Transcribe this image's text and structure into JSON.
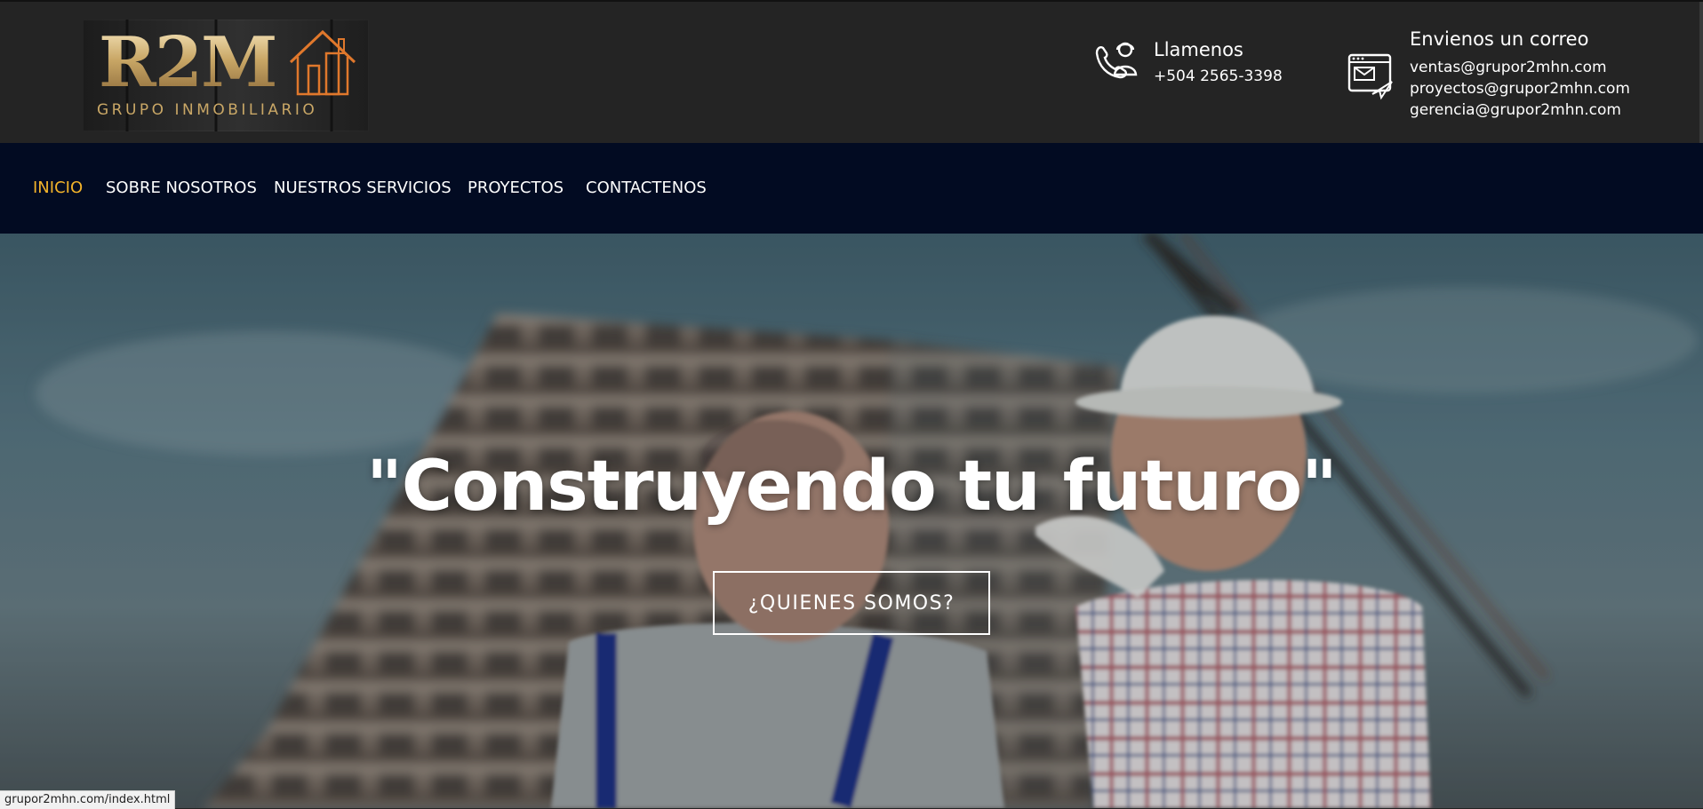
{
  "header": {
    "logo": {
      "mark": "R2M",
      "subtitle": "GRUPO INMOBILIARIO"
    },
    "phone": {
      "icon": "phone-agent-icon",
      "title": "Llamenos",
      "number": "+504 2565-3398"
    },
    "email": {
      "icon": "email-window-icon",
      "title": "Envienos un correo",
      "addresses": [
        "ventas@grupor2mhn.com",
        "proyectos@grupor2mhn.com",
        "gerencia@grupor2mhn.com"
      ]
    }
  },
  "nav": {
    "items": [
      {
        "label": "INICIO",
        "active": true
      },
      {
        "label": "SOBRE NOSOTROS",
        "active": false
      },
      {
        "label": "NUESTROS SERVICIOS",
        "active": false
      },
      {
        "label": "PROYECTOS",
        "active": false
      },
      {
        "label": "CONTACTENOS",
        "active": false
      }
    ],
    "active_color": "#f2b32a"
  },
  "hero": {
    "title": "\"Construyendo tu futuro\"",
    "button_label": "¿QUIENES SOMOS?"
  },
  "status_bar": {
    "url": "grupor2mhn.com/index.html"
  },
  "colors": {
    "header_bg": "#242424",
    "nav_bg": "#020b22",
    "logo_gold": "#c9a766",
    "logo_orange": "#e0782c"
  }
}
